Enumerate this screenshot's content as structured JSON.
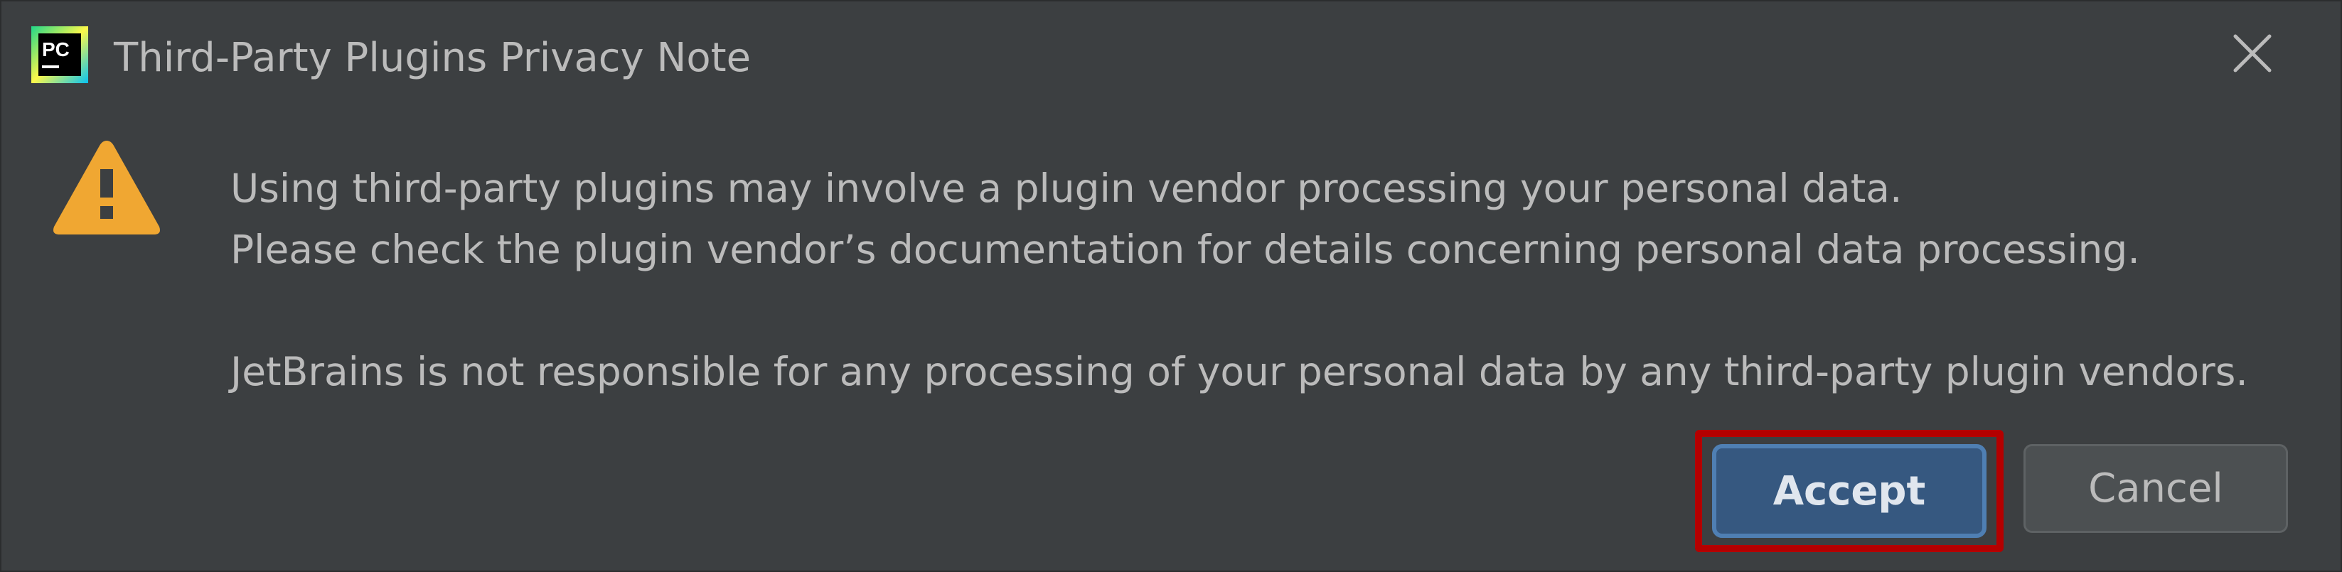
{
  "window": {
    "title": "Third-Party Plugins Privacy Note",
    "app_icon_text": "PC"
  },
  "message": {
    "line1": "Using third-party plugins may involve a plugin vendor processing your personal data.",
    "line2": "Please check the plugin vendor’s documentation for details concerning personal data processing.",
    "line3": "JetBrains is not responsible for any processing of your personal data by any third-party plugin vendors."
  },
  "buttons": {
    "accept_label": "Accept",
    "cancel_label": "Cancel"
  },
  "icons": {
    "app": "pycharm-icon",
    "warning": "warning-icon",
    "close": "close-icon"
  },
  "colors": {
    "background": "#3c3f41",
    "text": "#bbbbbb",
    "warning": "#f0a732",
    "accept_bg": "#365880",
    "highlight": "#b40000"
  }
}
